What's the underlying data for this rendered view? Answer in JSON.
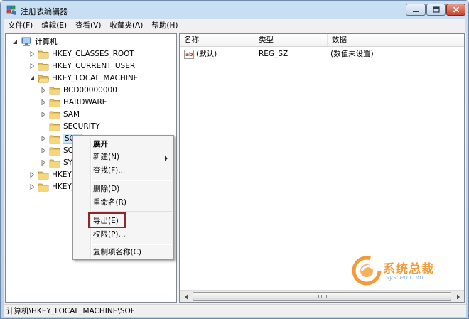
{
  "window": {
    "title": "注册表编辑器",
    "min_glyph": "─",
    "max_glyph": "□",
    "close_glyph": "✕"
  },
  "menubar": [
    "文件(F)",
    "编辑(E)",
    "查看(V)",
    "收藏夹(A)",
    "帮助(H)"
  ],
  "tree": {
    "root": "计算机",
    "items": [
      {
        "label": "HKEY_CLASSES_ROOT",
        "level": 1,
        "expander": "collapsed"
      },
      {
        "label": "HKEY_CURRENT_USER",
        "level": 1,
        "expander": "collapsed"
      },
      {
        "label": "HKEY_LOCAL_MACHINE",
        "level": 1,
        "expander": "expanded"
      },
      {
        "label": "BCD00000000",
        "level": 2,
        "expander": "collapsed"
      },
      {
        "label": "HARDWARE",
        "level": 2,
        "expander": "collapsed"
      },
      {
        "label": "SAM",
        "level": 2,
        "expander": "collapsed"
      },
      {
        "label": "SECURITY",
        "level": 2,
        "expander": "none"
      },
      {
        "label": "SOF",
        "level": 2,
        "expander": "collapsed",
        "selected": true
      },
      {
        "label": "SOF",
        "level": 2,
        "expander": "collapsed"
      },
      {
        "label": "SYST",
        "level": 2,
        "expander": "collapsed"
      },
      {
        "label": "HKEY_U",
        "level": 1,
        "expander": "collapsed"
      },
      {
        "label": "HKEY_C",
        "level": 1,
        "expander": "collapsed"
      }
    ]
  },
  "list": {
    "columns": [
      "名称",
      "类型",
      "数据"
    ],
    "rows": [
      {
        "icon": "string-value-icon",
        "name": "(默认)",
        "type": "REG_SZ",
        "data": "(数值未设置)"
      }
    ]
  },
  "context_menu": {
    "items": [
      "展开",
      "新建(N)",
      "查找(F)...",
      "删除(D)",
      "重命名(R)",
      "导出(E)",
      "权限(P)...",
      "复制项名称(C)"
    ],
    "highlighted": "导出(E)",
    "highlight_color": "#8c2a2a"
  },
  "statusbar": "计算机\\HKEY_LOCAL_MACHINE\\SOF",
  "watermark": {
    "text": "系统总裁",
    "sub": "sysceo.com",
    "color": "#f39a3a"
  }
}
